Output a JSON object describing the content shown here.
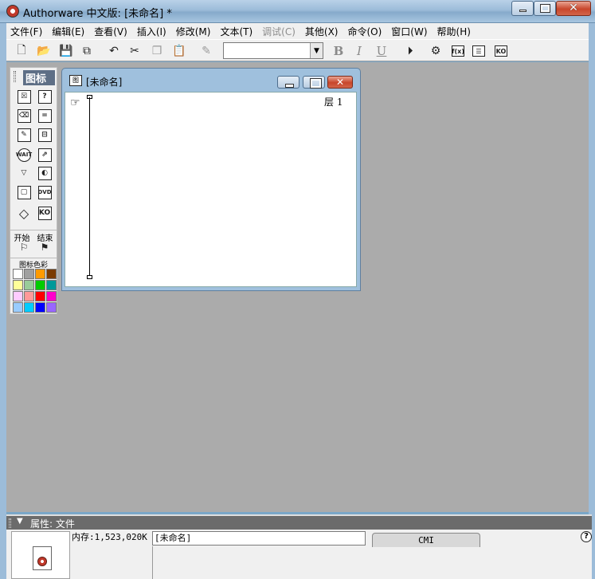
{
  "window": {
    "title": "Authorware 中文版: [未命名] *",
    "min_glyph": "",
    "close_glyph": "✕"
  },
  "menu": [
    {
      "label": "文件(F)",
      "enabled": true
    },
    {
      "label": "编辑(E)",
      "enabled": true
    },
    {
      "label": "查看(V)",
      "enabled": true
    },
    {
      "label": "插入(I)",
      "enabled": true
    },
    {
      "label": "修改(M)",
      "enabled": true
    },
    {
      "label": "文本(T)",
      "enabled": true
    },
    {
      "label": "调试(C)",
      "enabled": false
    },
    {
      "label": "其他(X)",
      "enabled": true
    },
    {
      "label": "命令(O)",
      "enabled": true
    },
    {
      "label": "窗口(W)",
      "enabled": true
    },
    {
      "label": "帮助(H)",
      "enabled": true
    }
  ],
  "toolbar": {
    "font_combo_value": "",
    "bold_label": "B",
    "italic_label": "I",
    "underline_label": "U",
    "fn_label": "f(x)",
    "ko_label": "KO",
    "icons": [
      "new-file-icon",
      "open-folder-icon",
      "save-all-icon",
      "import-icon",
      "undo-icon",
      "cut-icon",
      "copy-icon",
      "paste-icon",
      "find-icon",
      "run-icon",
      "control-panel-icon",
      "functions-icon",
      "variables-icon",
      "knowledge-objects-icon"
    ]
  },
  "palette": {
    "title": "图标",
    "wait_label": "WAIT",
    "dvd_label": "DVD",
    "ko_label": "KO",
    "start_label": "开始",
    "end_label": "结束",
    "colors_title": "图标色彩",
    "swatches": [
      "#ffffff",
      "#a0a0a0",
      "#ff9a00",
      "#7a3a00",
      "#ffff99",
      "#99cc99",
      "#00cc00",
      "#009999",
      "#ffccff",
      "#ff9999",
      "#ff0000",
      "#ff00cc",
      "#99ccff",
      "#00ccff",
      "#0000ff",
      "#9966ff"
    ]
  },
  "document": {
    "title": "[未命名]",
    "icon_label": "图",
    "close_glyph": "✕",
    "layer_label": "层 1"
  },
  "properties": {
    "header": "属性: 文件",
    "memory": "内存:1,523,020K",
    "file_name": "[未命名]",
    "tab_label": "CMI",
    "help_glyph": "?"
  }
}
